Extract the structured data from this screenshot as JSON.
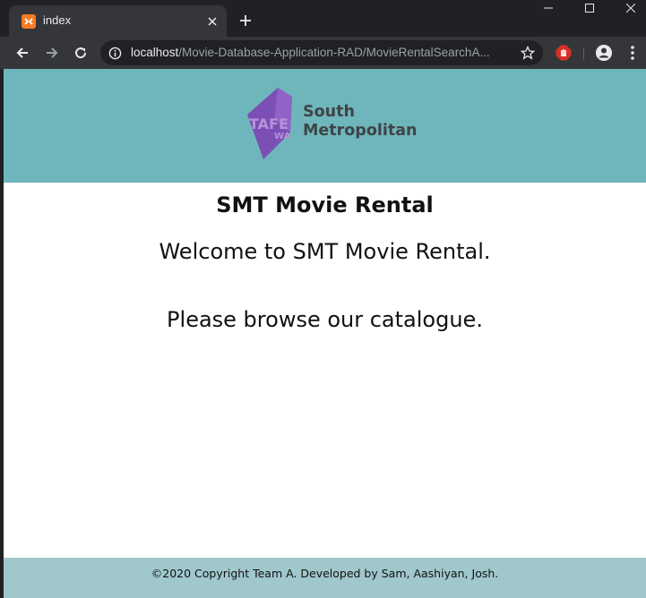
{
  "browser": {
    "tab_title": "index",
    "url_host": "localhost",
    "url_path": "/Movie-Database-Application-RAD/MovieRentalSearchA..."
  },
  "header": {
    "logo_mark": "TAFE",
    "logo_mark_sub": "WA",
    "logo_line1": "South",
    "logo_line2": "Metropolitan",
    "bg_color": "#6fb6bc"
  },
  "main": {
    "title": "SMT Movie Rental",
    "welcome": "Welcome to SMT Movie Rental.",
    "browse": "Please browse our catalogue."
  },
  "footer": {
    "text": "©2020 Copyright Team A. Developed by Sam, Aashiyan, Josh.",
    "bg_color": "#9fc7cc"
  },
  "icons": {
    "favicon": "xampp-icon",
    "close": "close-icon",
    "new_tab": "plus-icon",
    "back": "arrow-left-icon",
    "forward": "arrow-right-icon",
    "reload": "reload-icon",
    "info": "info-icon",
    "bookmark": "star-icon",
    "extension": "stop-hand-icon",
    "profile": "account-icon",
    "menu": "kebab-menu-icon"
  }
}
